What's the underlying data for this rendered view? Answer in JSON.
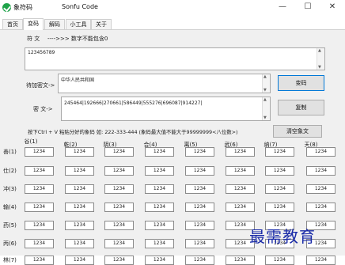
{
  "titlebar": {
    "app_name": "象符码",
    "window_title": "Sonfu Code",
    "minimize": "—",
    "maximize": "☐",
    "close": "✕"
  },
  "tabs": [
    "首页",
    "变码",
    "解码",
    "小工具",
    "关于"
  ],
  "active_tab": "变码",
  "secret": {
    "label": "符 文",
    "hint": "---->>> 数字不能包含0",
    "value": "123456789"
  },
  "plain": {
    "label": "待加密文->",
    "value": "中华人民共和国"
  },
  "cipher": {
    "label": "密 文->",
    "value": "245464|192666|270661|586449|555276|696087|914227|"
  },
  "buttons": {
    "encode": "变码",
    "copy": "复制",
    "clear": "清空象文"
  },
  "shortcut_text": "按下Ctrl + V 粘贴分好的象码 如: 222-333-444  (象码最大值不能大于99999999<八位数>)",
  "grid": {
    "columns": [
      "谷(1)",
      "乾(2)",
      "阴(3)",
      "合(4)",
      "离(5)",
      "武(6)",
      "纳(7)",
      "天(8)"
    ],
    "rows": [
      "善(1)",
      "仕(2)",
      "冲(3)",
      "输(4)",
      "药(5)",
      "丙(6)",
      "林(7)"
    ],
    "cell_value": "1234"
  },
  "watermark": "最需教育"
}
